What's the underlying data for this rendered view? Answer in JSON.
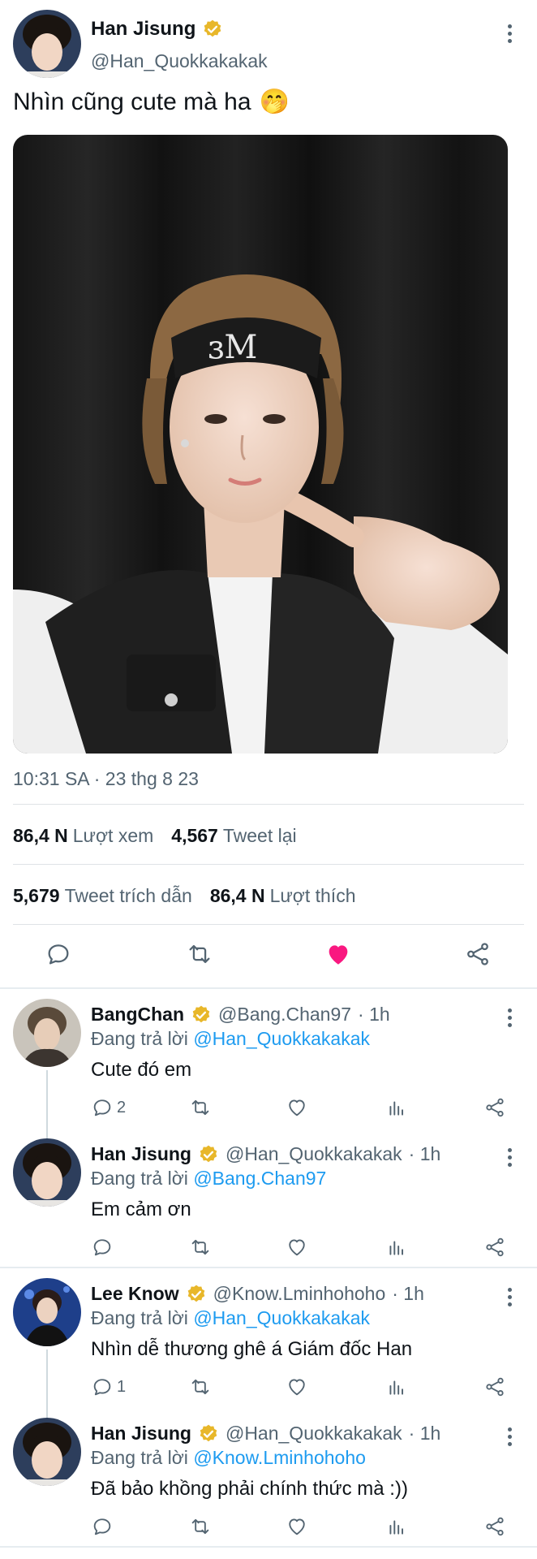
{
  "main_tweet": {
    "name": "Han Jisung",
    "handle": "@Han_Quokkakakak",
    "text": "Nhìn cũng cute mà ha",
    "emoji": "🤭",
    "timestamp": "10:31 SA · 23 thg 8 23",
    "stats_row1": [
      {
        "value": "86,4 N",
        "label": "Lượt xem"
      },
      {
        "value": "4,567",
        "label": "Tweet lại"
      }
    ],
    "stats_row2": [
      {
        "value": "5,679",
        "label": "Tweet trích dẫn"
      },
      {
        "value": "86,4 N",
        "label": "Lượt thích"
      }
    ],
    "liked": true
  },
  "replies": [
    {
      "name": "BangChan",
      "handle": "@Bang.Chan97",
      "time": "· 1h",
      "replying_prefix": "Đang trả lời",
      "replying_to": "@Han_Quokkakakak",
      "text": "Cute đó em",
      "reply_count": "2"
    },
    {
      "name": "Han Jisung",
      "handle": "@Han_Quokkakakak",
      "time": "· 1h",
      "replying_prefix": "Đang trả lời",
      "replying_to": "@Bang.Chan97",
      "text": "Em cảm ơn",
      "reply_count": ""
    },
    {
      "name": "Lee Know",
      "handle": "@Know.Lminhohoho",
      "time": "· 1h",
      "replying_prefix": "Đang trả lời",
      "replying_to": "@Han_Quokkakakak",
      "text": "Nhìn dễ thương ghê á Giám đốc Han",
      "reply_count": "1"
    },
    {
      "name": "Han Jisung",
      "handle": "@Han_Quokkakakak",
      "time": "· 1h",
      "replying_prefix": "Đang trả lời",
      "replying_to": "@Know.Lminhohoho",
      "text": "Đã bảo khồng phải chính thức mà :))",
      "reply_count": ""
    }
  ],
  "colors": {
    "verified": "#e8b72a",
    "like": "#f91880",
    "link": "#1d9bf0",
    "secondary_text": "#536471"
  }
}
